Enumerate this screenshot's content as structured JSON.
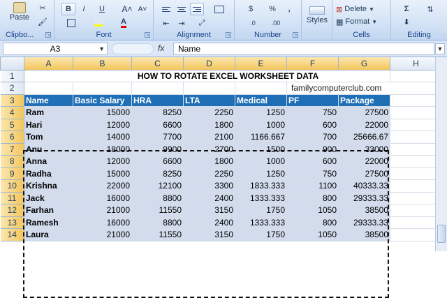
{
  "ribbon": {
    "clipboard": {
      "label": "Clipbo...",
      "paste_label": "Paste"
    },
    "font": {
      "label": "Font",
      "bold": "B",
      "italic": "I",
      "underline": "U",
      "grow": "A˄",
      "shrink": "A˅"
    },
    "alignment": {
      "label": "Alignment"
    },
    "number": {
      "label": "Number",
      "currency": "$",
      "percent": "%",
      "comma": ",",
      "inc_decimal": ".0",
      "dec_decimal": ".00"
    },
    "styles": {
      "label": "Styles"
    },
    "cells": {
      "label": "Cells",
      "delete": "Delete",
      "format": "Format"
    },
    "editing": {
      "label": "Editing"
    }
  },
  "formula_bar": {
    "name_box": "A3",
    "fx": "fx",
    "content": "Name"
  },
  "columns": [
    "A",
    "B",
    "C",
    "D",
    "E",
    "F",
    "G",
    "H"
  ],
  "rows": [
    "1",
    "2",
    "3",
    "4",
    "5",
    "6",
    "7",
    "8",
    "9",
    "10",
    "11",
    "12",
    "13",
    "14"
  ],
  "title": "HOW TO ROTATE EXCEL WORKSHEET DATA",
  "website": "familycomputerclub.com",
  "headers": [
    "Name",
    "Basic Salary",
    "HRA",
    "LTA",
    "Medical",
    "PF",
    "Package"
  ],
  "data": [
    [
      "Ram",
      "15000",
      "8250",
      "2250",
      "1250",
      "750",
      "27500"
    ],
    [
      "Hari",
      "12000",
      "6600",
      "1800",
      "1000",
      "600",
      "22000"
    ],
    [
      "Tom",
      "14000",
      "7700",
      "2100",
      "1166.667",
      "700",
      "25666.67"
    ],
    [
      "Anu",
      "18000",
      "9900",
      "2700",
      "1500",
      "900",
      "33000"
    ],
    [
      "Anna",
      "12000",
      "6600",
      "1800",
      "1000",
      "600",
      "22000"
    ],
    [
      "Radha",
      "15000",
      "8250",
      "2250",
      "1250",
      "750",
      "27500"
    ],
    [
      "Krishna",
      "22000",
      "12100",
      "3300",
      "1833.333",
      "1100",
      "40333.33"
    ],
    [
      "Jack",
      "16000",
      "8800",
      "2400",
      "1333.333",
      "800",
      "29333.33"
    ],
    [
      "Farhan",
      "21000",
      "11550",
      "3150",
      "1750",
      "1050",
      "38500"
    ],
    [
      "Ramesh",
      "16000",
      "8800",
      "2400",
      "1333.333",
      "800",
      "29333.33"
    ],
    [
      "Laura",
      "21000",
      "11550",
      "3150",
      "1750",
      "1050",
      "38500"
    ]
  ]
}
